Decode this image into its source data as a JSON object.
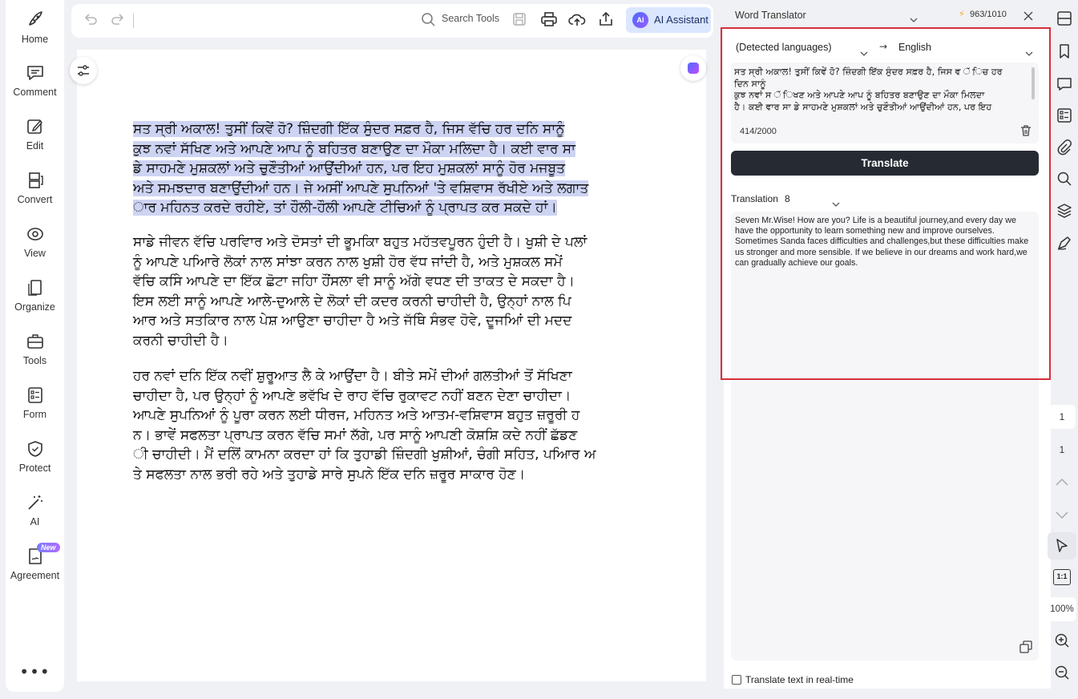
{
  "leftnav": {
    "items": [
      {
        "label": "Home",
        "icon": "rocket-icon"
      },
      {
        "label": "Comment",
        "icon": "comment-icon"
      },
      {
        "label": "Edit",
        "icon": "edit-icon"
      },
      {
        "label": "Convert",
        "icon": "convert-icon"
      },
      {
        "label": "View",
        "icon": "eye-icon"
      },
      {
        "label": "Organize",
        "icon": "organize-icon"
      },
      {
        "label": "Tools",
        "icon": "toolbox-icon"
      },
      {
        "label": "Form",
        "icon": "form-icon"
      },
      {
        "label": "Protect",
        "icon": "shield-icon"
      },
      {
        "label": "AI",
        "icon": "magic-wand-icon"
      },
      {
        "label": "Agreement",
        "icon": "agreement-icon",
        "badge": "New"
      }
    ],
    "more": "•••"
  },
  "toolbar": {
    "search_label": "Search Tools",
    "ai_logo": "AI",
    "ai_label": "AI Assistant"
  },
  "document": {
    "para1": "ਸਤ ਸ੍ਰੀ ਅਕਾਲ! ਤੁਸੀਂ ਕਿਵੇਂ ਹੋ? ਜ਼ਿੰਦਗੀ ਇੱਕ ਸੁੰਦਰ ਸਫ਼ਰ ਹੈ, ਜਿਸ ਵੱਚਿ ਹਰ ਦਨਿ ਸਾਨੂੰ\nਕੁਝ ਨਵਾਂ ਸੱਖਿਣ ਅਤੇ ਆਪਣੇ ਆਪ ਨੂੰ ਬਹਿਤਰ ਬਣਾਉਣ ਦਾ ਮੌਕਾ ਮਲਿਦਾ ਹੈ। ਕਈ ਵਾਰ ਸਾ\nਡੇ ਸਾਹਮਣੇ ਮੁਸ਼ਕਲਾਂ ਅਤੇ ਚੁਣੌਤੀਆਂ ਆਉਂਦੀਆਂ ਹਨ, ਪਰ ਇਹ ਮੁਸ਼ਕਲਾਂ ਸਾਨੂੰ ਹੋਰ ਮਜਬੂਤ\nਅਤੇ ਸਮਝਦਾਰ ਬਣਾਉਂਦੀਆਂ ਹਨ। ਜੇ ਅਸੀਂ ਆਪਣੇ ਸੁਪਨਿਆਂ 'ਤੇ ਵਸ਼ਿਵਾਸ ਰੱਖੀਏ ਅਤੇ ਲਗਾਤ\nਾਰ ਮਹਿਨਤ ਕਰਦੇ ਰਹੀਏ, ਤਾਂ ਹੌਲੀ-ਹੌਲੀ ਆਪਣੇ ਟੀਚਿਆਂ ਨੂੰ ਪ੍ਰਾਪਤ ਕਰ ਸਕਦੇ ਹਾਂ।",
    "para2": "ਸਾਡੇ ਜੀਵਨ ਵੱਚਿ ਪਰਵਿਾਰ ਅਤੇ ਦੋਸਤਾਂ ਦੀ ਭੂਮਕਿਾ ਬਹੁਤ ਮਹੱਤਵਪੂਰਨ ਹੁੰਦੀ ਹੈ। ਖੁਸ਼ੀ ਦੇ ਪਲਾਂ\nਨੂੰ ਆਪਣੇ ਪਆਿਰੇ ਲੋਕਾਂ ਨਾਲ ਸਾਂਝਾ ਕਰਨ ਨਾਲ ਖੁਸ਼ੀ ਹੋਰ ਵੱਧ ਜਾਂਦੀ ਹੈ, ਅਤੇ ਮੁਸ਼ਕਲ ਸਮੇਂ\nਵੱਚਿ ਕਸਿੇ ਆਪਣੇ ਦਾ ਇੱਕ ਛੋਟਾ ਜਹਿਾ ਹੌਂਸਲਾ ਵੀ ਸਾਨੂੰ ਅੱਗੇ ਵਧਣ ਦੀ ਤਾਕਤ ਦੇ ਸਕਦਾ ਹੈ।\nਇਸ ਲਈ ਸਾਨੂੰ ਆਪਣੇ ਆਲੇ-ਦੁਆਲੇ ਦੇ ਲੋਕਾਂ ਦੀ ਕਦਰ ਕਰਨੀ ਚਾਹੀਦੀ ਹੈ, ਉਨ੍ਹਾਂ ਨਾਲ ਪਿ\nਆਰ ਅਤੇ ਸਤਕਿਾਰ ਨਾਲ ਪੇਸ਼ ਆਉਣਾ ਚਾਹੀਦਾ ਹੈ ਅਤੇ ਜੱਥਿੇ ਸੰਭਵ ਹੋਵੇ, ਦੂਜਆਿਂ ਦੀ ਮਦਦ\nਕਰਨੀ ਚਾਹੀਦੀ ਹੈ।",
    "para3": "ਹਰ ਨਵਾਂ ਦਨਿ ਇੱਕ ਨਵੀਂ ਸ਼ੁਰੂਆਤ ਲੈ ਕੇ ਆਉਂਦਾ ਹੈ। ਬੀਤੇ ਸਮੇਂ ਦੀਆਂ ਗਲਤੀਆਂ ਤੋਂ ਸੱਖਿਣਾ\nਚਾਹੀਦਾ ਹੈ, ਪਰ ਉਨ੍ਹਾਂ ਨੂੰ ਆਪਣੇ ਭਵੱਖਿ ਦੇ ਰਾਹ ਵੱਚਿ ਰੁਕਾਵਟ ਨਹੀਂ ਬਣਨ ਦੇਣਾ ਚਾਹੀਦਾ।\nਆਪਣੇ ਸੁਪਨਿਆਂ ਨੂੰ ਪੂਰਾ ਕਰਨ ਲਈ ਧੀਰਜ, ਮਹਿਨਤ ਅਤੇ ਆਤਮ-ਵਸ਼ਿਵਾਸ ਬਹੁਤ ਜ਼ਰੂਰੀ ਹ\nਨ। ਭਾਵੇਂ ਸਫਲਤਾ ਪ੍ਰਾਪਤ ਕਰਨ ਵੱਚਿ ਸਮਾਂ ਲੱਗੇ, ਪਰ ਸਾਨੂੰ ਆਪਣੀ ਕੋਸ਼ਸ਼ਿ ਕਦੇ ਨਹੀਂ ਛੱਡਣ\nੀ ਚਾਹੀਦੀ। ਮੈਂ ਦਲਿੋਂ ਕਾਮਨਾ ਕਰਦਾ ਹਾਂ ਕਿ ਤੁਹਾਡੀ ਜ਼ਿੰਦਗੀ ਖੁਸ਼ੀਆਂ, ਚੰਗੀ ਸਹਿਤ, ਪਆਿਰ ਅ\nਤੇ ਸਫਲਤਾ ਨਾਲ ਭਰੀ ਰਹੇ ਅਤੇ ਤੁਹਾਡੇ ਸਾਰੇ ਸੁਪਨੇ ਇੱਕ ਦਨਿ ਜ਼ਰੂਰ ਸਾਕਾਰ ਹੋਣ।"
  },
  "translator": {
    "title": "Word Translator",
    "credits": "963/1010",
    "source_lang": "(Detected languages)",
    "arrow": "→",
    "target_lang": "English",
    "source_text": "ਸਤ ਸ੍ਰੀ ਅਕਾਲ! ਤੁਸੀਂ ਕਿਵੇਂ ਹੋ? ਜ਼ਿੰਦਗੀ ਇੱਕ ਸੁੰਦਰ ਸਫ਼ਰ ਹੈ, ਜਿਸ ਵ ੱ ਿਚ ਹਰ\nਦਿਨ ਸਾਨੂੰ\nਕੁਝ ਨਵਾਂ ਸ ੱ ਿਖਣ ਅਤੇ ਆਪਣੇ ਆਪ ਨੂੰ ਬਹਿਤਰ ਬਣਾਉਣ ਦਾ ਮੌਕਾ ਮਿਲਦਾ\nਹੈ। ਕਈ ਵਾਰ ਸਾ ਡੇ ਸਾਹਮਣੇ ਮੁਸ਼ਕਲਾਂ ਅਤੇ ਚੁਣੌਤੀਆਂ ਆਉਂਦੀਆਂ ਹਨ, ਪਰ ਇਹ",
    "char_count": "414/2000",
    "translate_button": "Translate",
    "translation_label": "Translation",
    "translation_option": "8",
    "translation_text": "Seven Mr.Wise! How are you? Life is a beautiful journey,and every day we have the opportunity to learn something new and improve ourselves. Sometimes Sanda faces difficulties and challenges,but these difficulties make us stronger and more sensible. If we believe in our dreams and work hard,we can gradually achieve our goals.",
    "realtime_label": "Translate text in real-time"
  },
  "rightbar": {
    "page_current": "1",
    "page_total": "1",
    "fit_label": "1:1",
    "zoom": "100%"
  },
  "colors": {
    "highlight": "#cdd3f2",
    "translate_button": "#262a33",
    "red_frame": "#d4303b",
    "ai_button": "#dbe6ff"
  }
}
